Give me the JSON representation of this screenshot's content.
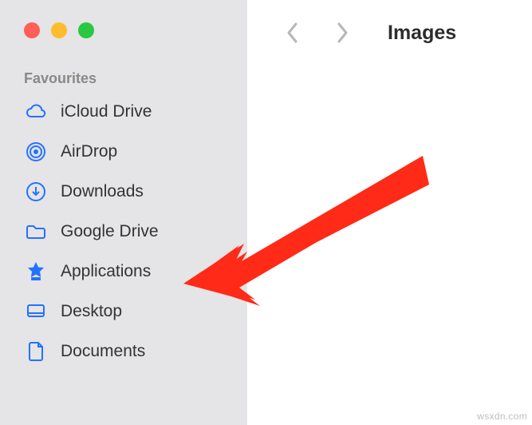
{
  "colors": {
    "accent": "#2372ff",
    "arrow": "#ff2a17"
  },
  "traffic_lights": [
    "close",
    "minimize",
    "zoom"
  ],
  "sidebar": {
    "section": "Favourites",
    "items": [
      {
        "label": "iCloud Drive",
        "icon": "cloud-icon"
      },
      {
        "label": "AirDrop",
        "icon": "airdrop-icon"
      },
      {
        "label": "Downloads",
        "icon": "download-icon"
      },
      {
        "label": "Google Drive",
        "icon": "folder-icon"
      },
      {
        "label": "Applications",
        "icon": "apps-icon"
      },
      {
        "label": "Desktop",
        "icon": "desktop-icon"
      },
      {
        "label": "Documents",
        "icon": "document-icon"
      }
    ]
  },
  "toolbar": {
    "back": "Back",
    "forward": "Forward",
    "title": "Images"
  },
  "watermark": "wsxdn.com",
  "annotation": {
    "target_item": "Applications"
  }
}
